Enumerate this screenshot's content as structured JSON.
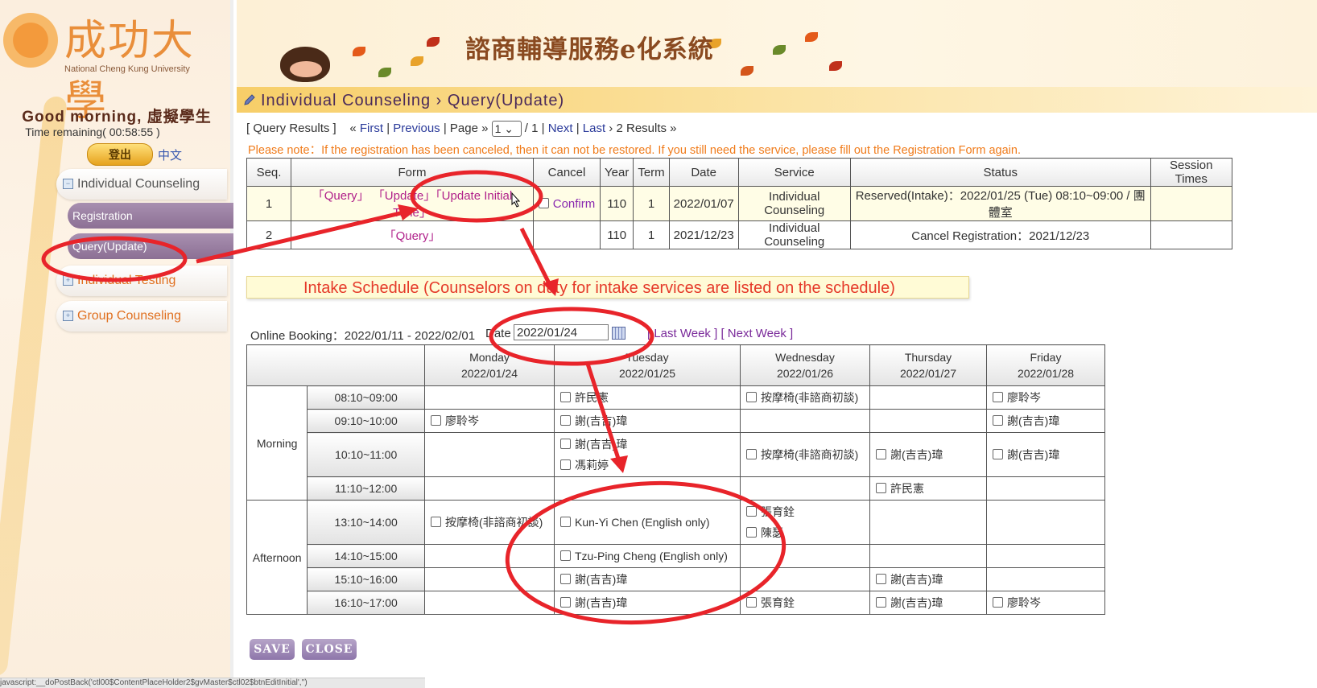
{
  "university": {
    "name_zh": "成功大學",
    "name_en": "National Cheng Kung University"
  },
  "banner": {
    "title": "諮商輔導服務e化系統"
  },
  "user": {
    "greeting": "Good morning, 虛擬學生",
    "time_remaining": "Time remaining( 00:58:55 )",
    "logout_label": "登出",
    "language_link": "中文"
  },
  "sidebar": {
    "individual_counseling": "Individual Counseling",
    "registration": "Registration",
    "query_update": "Query(Update)",
    "individual_testing": "Individual Testing",
    "group_counseling": "Group Counseling"
  },
  "section_header": "Individual Counseling › Query(Update)",
  "results_nav": {
    "label": "[ Query Results ]",
    "first": "First",
    "previous": "Previous",
    "page_label": "Page »",
    "page_value": "1",
    "page_total": "/  1",
    "next": "Next",
    "last": "Last",
    "count": "2 Results »"
  },
  "note": "Please note：If the registration has been canceled, then it can not be restored. If you still need the service, please fill out the Registration Form again.",
  "results_table": {
    "headers": [
      "Seq.",
      "Form",
      "Cancel",
      "Year",
      "Term",
      "Date",
      "Service",
      "Status",
      "Session Times"
    ],
    "rows": [
      {
        "seq": "1",
        "query": "「Query」",
        "update": "「Update」",
        "update_initial": "「Update Initial Time」",
        "cancel": "Confirm",
        "year": "110",
        "term": "1",
        "date": "2022/01/07",
        "service": "Individual Counseling",
        "status": "Reserved(Intake)：2022/01/25 (Tue) 08:10~09:00 / 團體室",
        "session_times": ""
      },
      {
        "seq": "2",
        "query": "「Query」",
        "cancel": "",
        "year": "110",
        "term": "1",
        "date": "2021/12/23",
        "service": "Individual Counseling",
        "status": "Cancel Registration：2021/12/23",
        "session_times": ""
      }
    ]
  },
  "intake_banner": "Intake Schedule (Counselors on duty for intake services are listed on the schedule)",
  "booking": {
    "online_booking": "Online Booking：2022/01/11 - 2022/02/01",
    "date_label": "Date",
    "date_value": "2022/01/24",
    "last_week": "[ Last Week ]",
    "next_week": "[ Next Week ]"
  },
  "schedule": {
    "days": [
      {
        "name": "Monday",
        "date": "2022/01/24"
      },
      {
        "name": "Tuesday",
        "date": "2022/01/25"
      },
      {
        "name": "Wednesday",
        "date": "2022/01/26"
      },
      {
        "name": "Thursday",
        "date": "2022/01/27"
      },
      {
        "name": "Friday",
        "date": "2022/01/28"
      }
    ],
    "periods": {
      "morning": "Morning",
      "afternoon": "Afternoon"
    },
    "times": [
      "08:10~09:00",
      "09:10~10:00",
      "10:10~11:00",
      "11:10~12:00",
      "13:10~14:00",
      "14:10~15:00",
      "15:10~16:00",
      "16:10~17:00"
    ],
    "slots": {
      "t0": {
        "tue": [
          "許民憲"
        ],
        "wed": [
          "按摩椅(非諮商初談)"
        ],
        "fri": [
          "廖聆岑"
        ]
      },
      "t1": {
        "mon": [
          "廖聆岑"
        ],
        "tue": [
          "謝(吉吉)瑋"
        ],
        "fri": [
          "謝(吉吉)瑋"
        ]
      },
      "t2": {
        "tue": [
          "謝(吉吉)瑋",
          "馮莉婷"
        ],
        "wed": [
          "按摩椅(非諮商初談)"
        ],
        "thu": [
          "謝(吉吉)瑋"
        ],
        "fri": [
          "謝(吉吉)瑋"
        ]
      },
      "t3": {
        "thu": [
          "許民憲"
        ]
      },
      "t4": {
        "mon": [
          "按摩椅(非諮商初談)"
        ],
        "tue": [
          "Kun-Yi Chen (English only)"
        ],
        "wed": [
          "張育銓",
          "陳瑟"
        ]
      },
      "t5": {
        "tue": [
          "Tzu-Ping Cheng (English only)"
        ]
      },
      "t6": {
        "tue": [
          "謝(吉吉)瑋"
        ],
        "thu": [
          "謝(吉吉)瑋"
        ]
      },
      "t7": {
        "tue": [
          "謝(吉吉)瑋"
        ],
        "wed": [
          "張育銓"
        ],
        "thu": [
          "謝(吉吉)瑋"
        ],
        "fri": [
          "廖聆岑"
        ]
      }
    }
  },
  "buttons": {
    "save": "SAVE",
    "close": "CLOSE"
  },
  "status_bar": "javascript:__doPostBack('ctl00$ContentPlaceHolder2$gvMaster$ctl02$btnEditInitial','')",
  "colors": {
    "annotation": "#e8242a",
    "accent": "#8c7094",
    "note": "#f07b1a"
  }
}
